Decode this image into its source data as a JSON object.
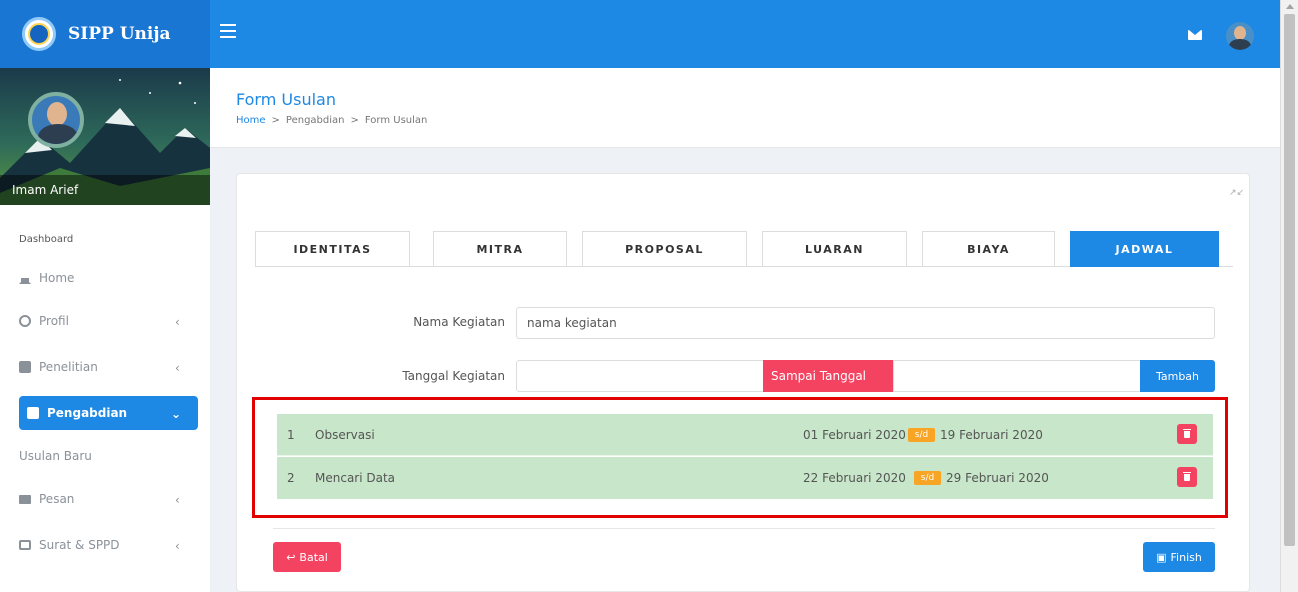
{
  "brand": {
    "title": "SIPP Unija"
  },
  "user": {
    "name": "Imam Arief"
  },
  "sidebar": {
    "heading": "Dashboard",
    "items": [
      {
        "label": "Home",
        "icon": "home-icon"
      },
      {
        "label": "Profil",
        "icon": "user-icon"
      },
      {
        "label": "Penelitian",
        "icon": "document-icon"
      },
      {
        "label": "Pengabdian",
        "icon": "document-icon"
      },
      {
        "label": "Pesan",
        "icon": "mail-icon"
      },
      {
        "label": "Surat & SPPD",
        "icon": "envelope-icon"
      }
    ],
    "subitem": "Usulan Baru"
  },
  "header": {
    "title": "Form Usulan",
    "breadcrumb": [
      "Home",
      "Pengabdian",
      "Form Usulan"
    ]
  },
  "tabs": [
    "IDENTITAS",
    "MITRA",
    "PROPOSAL",
    "LUARAN",
    "BIAYA",
    "JADWAL"
  ],
  "form": {
    "nama_label": "Nama Kegiatan",
    "nama_value": "nama kegiatan",
    "tanggal_label": "Tanggal Kegiatan",
    "sampai_label": "Sampai Tanggal",
    "tambah_label": "Tambah"
  },
  "schedule": [
    {
      "no": "1",
      "activity": "Observasi",
      "start": "01 Februari 2020",
      "sep": "s/d",
      "end": "19 Februari 2020"
    },
    {
      "no": "2",
      "activity": "Mencari Data",
      "start": "22 Februari 2020",
      "sep": "s/d",
      "end": "29 Februari 2020"
    }
  ],
  "actions": {
    "batal": "Batal",
    "finish": "Finish"
  },
  "colors": {
    "primary": "#1e88e5",
    "danger": "#f44361",
    "warning": "#f8a425",
    "success_bg": "#c8e6c9",
    "highlight": "#e00000"
  }
}
